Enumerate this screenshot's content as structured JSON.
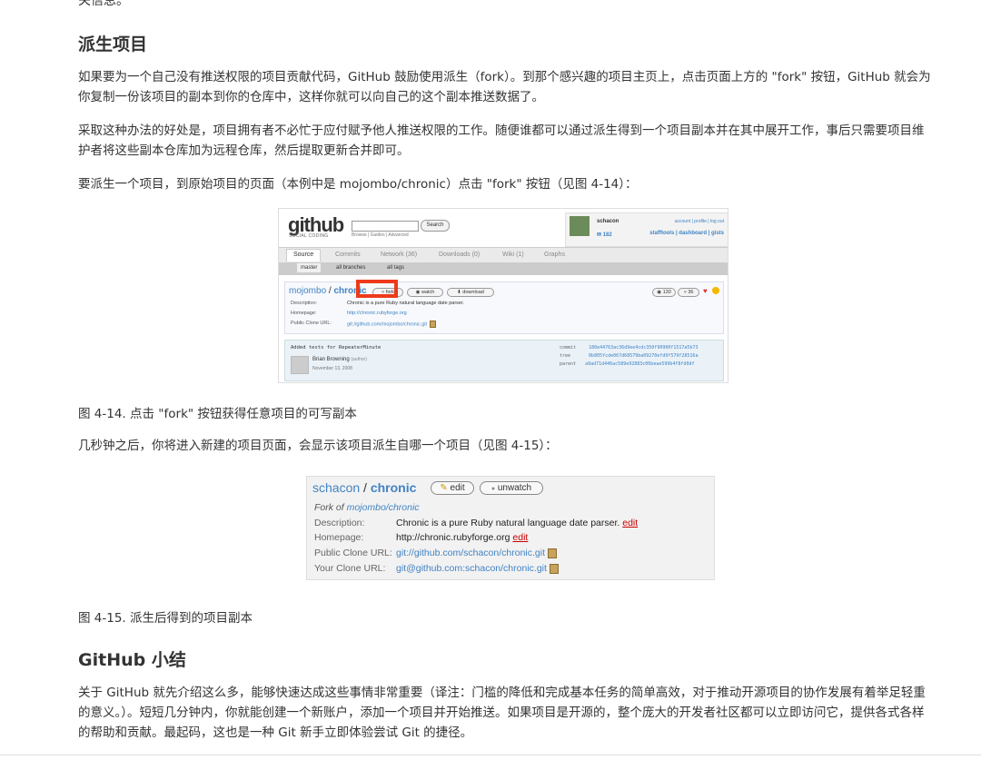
{
  "cut_text": "关信息。",
  "section1": {
    "heading": "派生项目",
    "p1": "如果要为一个自己没有推送权限的项目贡献代码，GitHub 鼓励使用派生（fork）。到那个感兴趣的项目主页上，点击页面上方的 \"fork\" 按钮，GitHub 就会为你复制一份该项目的副本到你的仓库中，这样你就可以向自己的这个副本推送数据了。",
    "p2": "采取这种办法的好处是，项目拥有者不必忙于应付赋予他人推送权限的工作。随便谁都可以通过派生得到一个项目副本并在其中展开工作，事后只需要项目维护者将这些副本仓库加为远程仓库，然后提取更新合并即可。",
    "p3": "要派生一个项目，到原始项目的页面（本例中是 mojombo/chronic）点击 \"fork\" 按钮（见图 4-14）：",
    "caption1": "图 4-14. 点击 \"fork\" 按钮获得任意项目的可写副本",
    "p4": "几秒钟之后，你将进入新建的项目页面，会显示该项目派生自哪一个项目（见图 4-15）：",
    "caption2": "图 4-15. 派生后得到的项目副本"
  },
  "section2": {
    "heading": "GitHub 小结",
    "p1": "关于 GitHub 就先介绍这么多，能够快速达成这些事情非常重要（译注：门槛的降低和完成基本任务的简单高效，对于推动开源项目的协作发展有着举足轻重的意义。）。短短几分钟内，你就能创建一个新账户，添加一个项目并开始推送。如果项目是开源的，整个庞大的开发者社区都可以立即访问它，提供各式各样的帮助和贡献。最起码，这也是一种 Git 新手立即体验尝试 Git 的捷径。"
  },
  "figure1": {
    "logo": "github",
    "logo_sub": "SOCIAL CODING",
    "search_button": "Search",
    "search_links": "Browse | Guides | Advanced",
    "username": "schacon",
    "mail_count": "182",
    "user_links": "account | profile | log out",
    "user_links2": "stafftools | dashboard | gists",
    "tabs": [
      "Source",
      "Commits",
      "Network (36)",
      "Downloads (0)",
      "Wiki (1)",
      "Graphs"
    ],
    "subtabs": [
      "master",
      "all branches",
      "all tags"
    ],
    "repo_owner": "mojombo",
    "repo_sep": " / ",
    "repo_name": "chronic",
    "btn_fork": "fork",
    "btn_watch": "watch",
    "btn_download": "download",
    "watchers": "130",
    "forks": "36",
    "desc_label": "Description:",
    "desc_value": "Chronic is a pure Ruby natural language date parser.",
    "home_label": "Homepage:",
    "home_value": "http://chronic.rubyforge.org",
    "clone_label": "Public Clone URL:",
    "clone_value": "git://github.com/mojombo/chronic.git",
    "commit_message": "Added tests for RepeaterMinute",
    "commit_author": "Brian Browning",
    "commit_author_role": "(author)",
    "commit_date": "November 13, 2008",
    "commit_label": "commit",
    "commit_hash": "180e44763ac36d9ee4cdc350f90900f1517a5b73",
    "tree_label": "tree",
    "tree_hash": "0b805fcde067d68579ba09270efd9f579f28516a",
    "parent_label": "parent",
    "parent_hash": "a9ad71d446ac589e92883c06beae599b4f8fd0df"
  },
  "figure2": {
    "owner": "schacon",
    "sep": " / ",
    "name": "chronic",
    "btn_edit": "edit",
    "btn_unwatch": "unwatch",
    "fork_of_prefix": "Fork of ",
    "fork_of_link": "mojombo/chronic",
    "desc_label": "Description:",
    "desc_value": "Chronic is a pure Ruby natural language date parser.",
    "home_label": "Homepage:",
    "home_value": "http://chronic.rubyforge.org",
    "edit_link": "edit",
    "public_label": "Public Clone URL:",
    "public_value": "git://github.com/schacon/chronic.git",
    "your_label": "Your Clone URL:",
    "your_value": "git@github.com:schacon/chronic.git"
  }
}
